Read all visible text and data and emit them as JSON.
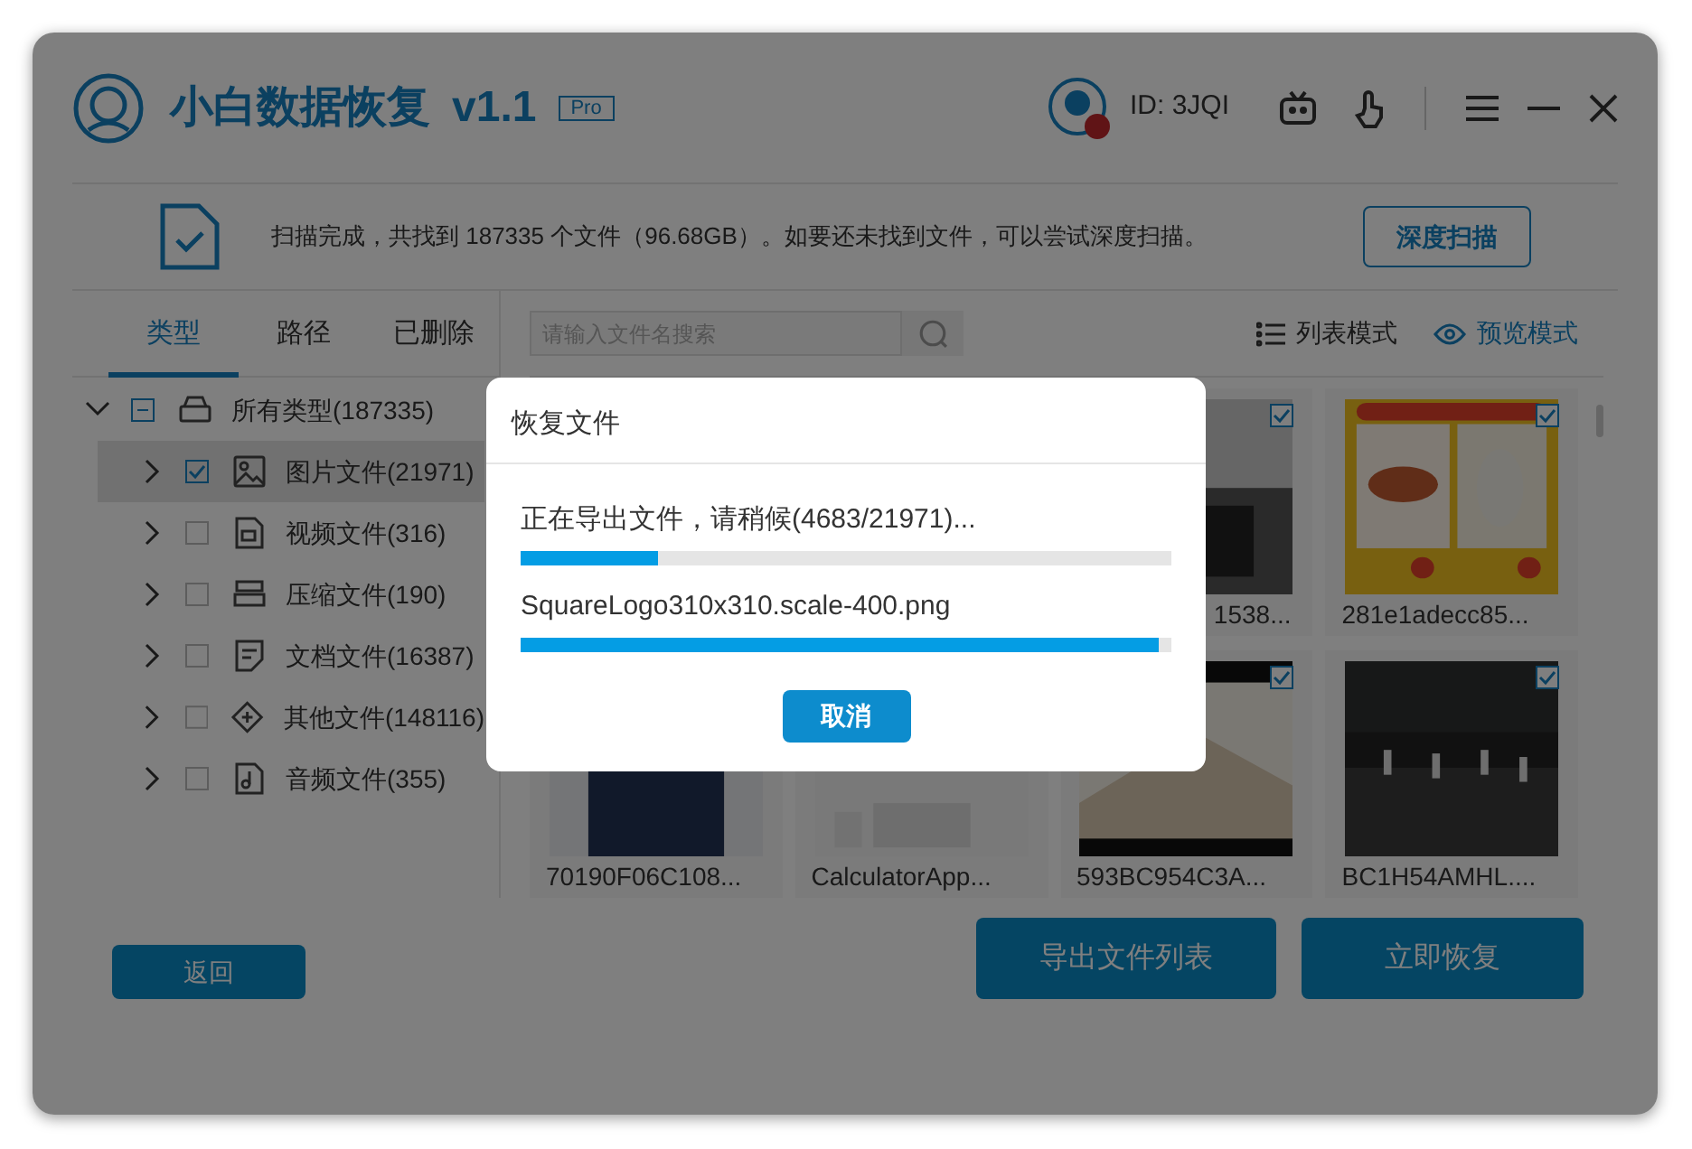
{
  "app": {
    "title": "小白数据恢复",
    "version": "v1.1",
    "edition": "Pro",
    "user_id": "ID: 3JQI"
  },
  "scan_summary": {
    "message": "扫描完成，共找到 187335 个文件（96.68GB）。如要还未找到文件，可以尝试深度扫描。",
    "deep_scan_button": "深度扫描"
  },
  "sidebar": {
    "tabs": [
      {
        "label": "类型",
        "selected": true
      },
      {
        "label": "路径",
        "selected": false
      },
      {
        "label": "已删除",
        "selected": false
      }
    ],
    "tree": [
      {
        "label": "所有类型(187335)",
        "expanded": true,
        "checked": false,
        "partial": true,
        "selected": false,
        "children": [
          {
            "label": "图片文件(21971)",
            "expanded": false,
            "checked": true,
            "selected": true
          },
          {
            "label": "视频文件(316)",
            "expanded": false,
            "checked": false,
            "selected": false
          },
          {
            "label": "压缩文件(190)",
            "expanded": false,
            "checked": false,
            "selected": false
          },
          {
            "label": "文档文件(16387)",
            "expanded": false,
            "checked": false,
            "selected": false
          },
          {
            "label": "其他文件(148116)",
            "expanded": false,
            "checked": false,
            "selected": false
          },
          {
            "label": "音频文件(355)",
            "expanded": false,
            "checked": false,
            "selected": false
          }
        ]
      }
    ]
  },
  "toolbar": {
    "search": {
      "placeholder": "请输入文件名搜索"
    },
    "view_modes": [
      {
        "label": "列表模式",
        "selected": false
      },
      {
        "label": "预览模式",
        "selected": true
      }
    ]
  },
  "files": [
    {
      "kind": "picture",
      "caption": "1538...",
      "checked": true,
      "partly_hidden": true
    },
    {
      "kind": "picture",
      "caption": "281e1adecc85...",
      "checked": true
    },
    {
      "kind": "picture",
      "caption": "70190F06C108..."
    },
    {
      "kind": "picture",
      "caption": "CalculatorApp..."
    },
    {
      "kind": "picture",
      "caption": "593BC954C3A...",
      "checked": true
    },
    {
      "kind": "picture",
      "caption": "BC1H54AMHL....",
      "checked": true
    }
  ],
  "footer": {
    "back_button": "返回",
    "export_button": "导出文件列表",
    "recover_button": "立即恢复"
  },
  "dialog": {
    "title": "恢复文件",
    "status": "正在导出文件，请稍候(4683/21971)...",
    "overall_progress": {
      "level": 0.21
    },
    "current_file": "SquareLogo310x310.scale-400.png",
    "file_progress": {
      "level": 0.98
    },
    "cancel_button": "取消"
  }
}
